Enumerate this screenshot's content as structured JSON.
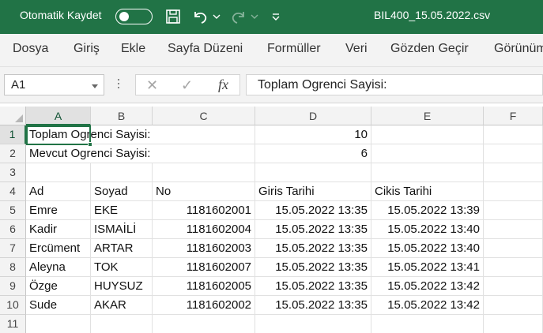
{
  "titlebar": {
    "autosave_label": "Otomatik Kaydet",
    "autosave_state": "Kapalı",
    "filename": "BIL400_15.05.2022.csv"
  },
  "ribbon": {
    "tabs": [
      "Dosya",
      "Giriş",
      "Ekle",
      "Sayfa Düzeni",
      "Formüller",
      "Veri",
      "Gözden Geçir",
      "Görünüm"
    ]
  },
  "formula_bar": {
    "name_box": "A1",
    "cancel_symbol": "✕",
    "enter_symbol": "✓",
    "fx_symbol": "fx",
    "content": "Toplam Ogrenci Sayisi:"
  },
  "sheet": {
    "columns": [
      "A",
      "B",
      "C",
      "D",
      "E",
      "F"
    ],
    "rows": [
      "1",
      "2",
      "3",
      "4",
      "5",
      "6",
      "7",
      "8",
      "9",
      "10",
      "11"
    ],
    "cells": {
      "r1": {
        "a": "Toplam Ogrenci Sayisi:",
        "d": "10"
      },
      "r2": {
        "a": "Mevcut Ogrenci Sayisi:",
        "d": "6"
      },
      "r4": {
        "a": "Ad",
        "b": "Soyad",
        "c": "No",
        "d": "Giris Tarihi",
        "e": "Cikis Tarihi"
      },
      "data": [
        {
          "a": "Emre",
          "b": "EKE",
          "c": "1181602001",
          "d": "15.05.2022 13:35",
          "e": "15.05.2022 13:39"
        },
        {
          "a": "Kadir",
          "b": "ISMAİLİ",
          "c": "1181602004",
          "d": "15.05.2022 13:35",
          "e": "15.05.2022 13:40"
        },
        {
          "a": "Ercüment",
          "b": "ARTAR",
          "c": "1181602003",
          "d": "15.05.2022 13:35",
          "e": "15.05.2022 13:40"
        },
        {
          "a": "Aleyna",
          "b": "TOK",
          "c": "1181602007",
          "d": "15.05.2022 13:35",
          "e": "15.05.2022 13:41"
        },
        {
          "a": "Özge",
          "b": "HUYSUZ",
          "c": "1181602005",
          "d": "15.05.2022 13:35",
          "e": "15.05.2022 13:42"
        },
        {
          "a": "Sude",
          "b": "AKAR",
          "c": "1181602002",
          "d": "15.05.2022 13:35",
          "e": "15.05.2022 13:42"
        }
      ]
    },
    "active_cell": "A1"
  },
  "colors": {
    "accent": "#217346",
    "ribbon_bg": "#f3f3f3",
    "header_bg": "#f3f3f3",
    "grid_line": "#e1e1e1"
  },
  "icons": [
    "save-icon",
    "undo-icon",
    "redo-icon",
    "customize-quick-access-icon",
    "name-box-dropdown-icon",
    "cancel-icon",
    "enter-icon",
    "insert-function-icon"
  ]
}
